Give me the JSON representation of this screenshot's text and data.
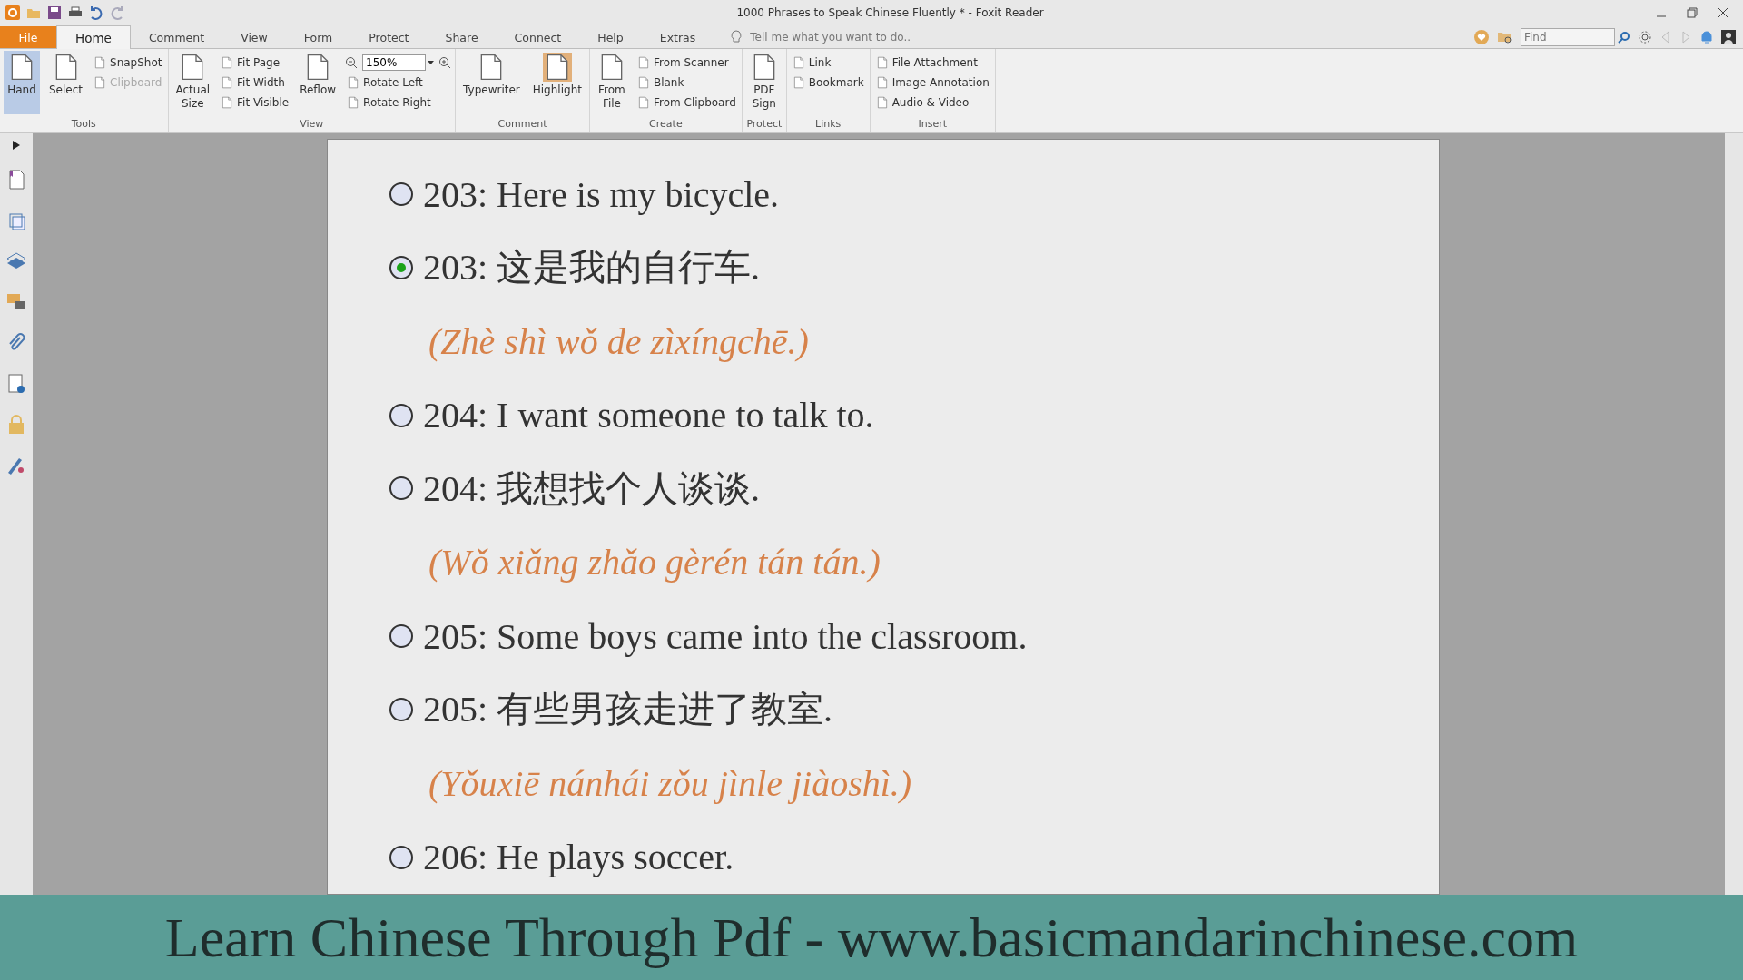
{
  "window": {
    "title": "1000 Phrases to Speak Chinese Fluently * - Foxit Reader"
  },
  "tabs": [
    {
      "label": "File",
      "kind": "file",
      "selected": false
    },
    {
      "label": "Home",
      "kind": "tab",
      "selected": true
    },
    {
      "label": "Comment",
      "kind": "tab",
      "selected": false
    },
    {
      "label": "View",
      "kind": "tab",
      "selected": false
    },
    {
      "label": "Form",
      "kind": "tab",
      "selected": false
    },
    {
      "label": "Protect",
      "kind": "tab",
      "selected": false
    },
    {
      "label": "Share",
      "kind": "tab",
      "selected": false
    },
    {
      "label": "Connect",
      "kind": "tab",
      "selected": false
    },
    {
      "label": "Help",
      "kind": "tab",
      "selected": false
    },
    {
      "label": "Extras",
      "kind": "tab",
      "selected": false
    }
  ],
  "tell_me": {
    "placeholder": "Tell me what you want to do.."
  },
  "find": {
    "placeholder": "Find"
  },
  "ribbon": [
    {
      "label": "Tools",
      "items": [
        {
          "kind": "large",
          "label": "Hand",
          "selected": true
        },
        {
          "kind": "large",
          "label": "Select",
          "selected": false
        },
        {
          "kind": "stack",
          "buttons": [
            {
              "kind": "button",
              "label": "SnapShot",
              "disabled": false
            },
            {
              "kind": "button",
              "label": "Clipboard",
              "disabled": true
            }
          ]
        }
      ]
    },
    {
      "label": "View",
      "items": [
        {
          "kind": "large",
          "label": "Actual Size",
          "selected": false
        },
        {
          "kind": "stack",
          "buttons": [
            {
              "kind": "button",
              "label": "Fit Page",
              "disabled": false
            },
            {
              "kind": "button",
              "label": "Fit Width",
              "disabled": false
            },
            {
              "kind": "button",
              "label": "Fit Visible",
              "disabled": false
            }
          ]
        },
        {
          "kind": "large",
          "label": "Reflow",
          "selected": false
        },
        {
          "kind": "stack",
          "buttons": [
            {
              "kind": "zoom",
              "value": "150%"
            },
            {
              "kind": "button",
              "label": "Rotate Left",
              "disabled": false
            },
            {
              "kind": "button",
              "label": "Rotate Right",
              "disabled": false
            }
          ]
        }
      ]
    },
    {
      "label": "Comment",
      "items": [
        {
          "kind": "large",
          "label": "Typewriter",
          "selected": false
        },
        {
          "kind": "large",
          "label": "Highlight",
          "selected": true
        }
      ]
    },
    {
      "label": "Create",
      "items": [
        {
          "kind": "large",
          "label": "From File",
          "selected": false
        },
        {
          "kind": "stack",
          "buttons": [
            {
              "kind": "button",
              "label": "From Scanner",
              "disabled": false
            },
            {
              "kind": "button",
              "label": "Blank",
              "disabled": false
            },
            {
              "kind": "button",
              "label": "From Clipboard",
              "disabled": false
            }
          ]
        }
      ]
    },
    {
      "label": "Protect",
      "items": [
        {
          "kind": "large",
          "label": "PDF Sign",
          "selected": false
        }
      ]
    },
    {
      "label": "Links",
      "items": [
        {
          "kind": "stack",
          "buttons": [
            {
              "kind": "button",
              "label": "Link",
              "disabled": false
            },
            {
              "kind": "button",
              "label": "Bookmark",
              "disabled": false
            }
          ]
        }
      ]
    },
    {
      "label": "Insert",
      "items": [
        {
          "kind": "stack",
          "buttons": [
            {
              "kind": "button",
              "label": "File Attachment",
              "disabled": false
            },
            {
              "kind": "button",
              "label": "Image Annotation",
              "disabled": false
            },
            {
              "kind": "button",
              "label": "Audio & Video",
              "disabled": false
            }
          ]
        }
      ]
    }
  ],
  "document": {
    "items": [
      {
        "kind": "choice",
        "text": "203: Here is my bicycle.",
        "selected": false
      },
      {
        "kind": "choice",
        "text": "203: 这是我的自行车.",
        "selected": true
      },
      {
        "kind": "pinyin",
        "text": "(Zhè shì wǒ de zìxíngchē.)"
      },
      {
        "kind": "choice",
        "text": "204: I want someone to talk to.",
        "selected": false
      },
      {
        "kind": "choice",
        "text": "204: 我想找个人谈谈.",
        "selected": false
      },
      {
        "kind": "pinyin",
        "text": "(Wǒ xiǎng zhǎo gèrén tán tán.)"
      },
      {
        "kind": "choice",
        "text": "205: Some boys came into the classroom.",
        "selected": false
      },
      {
        "kind": "choice",
        "text": "205: 有些男孩走进了教室.",
        "selected": false
      },
      {
        "kind": "pinyin",
        "text": "(Yǒuxiē nánhái zǒu jìnle jiàoshì.)"
      },
      {
        "kind": "choice",
        "text": "206: He plays soccer.",
        "selected": false
      }
    ]
  },
  "banner": {
    "text": "Learn Chinese Through Pdf - www.basicmandarinchinese.com"
  }
}
